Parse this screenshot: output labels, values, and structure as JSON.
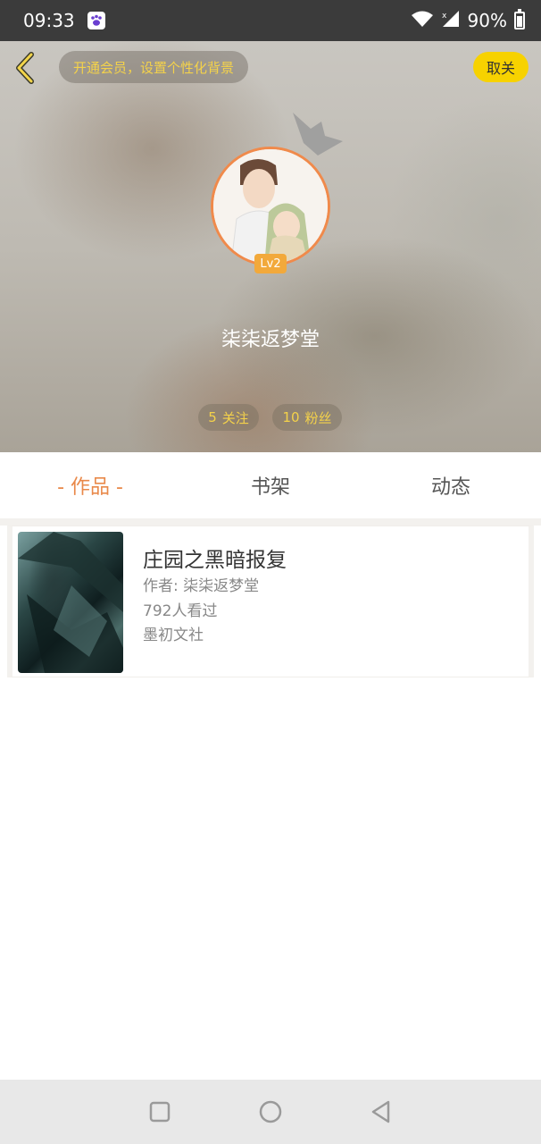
{
  "status_bar": {
    "time": "09:33",
    "battery": "90%"
  },
  "header": {
    "vip_banner": "开通会员，设置个性化背景",
    "unfollow_label": "取关",
    "level": "Lv2",
    "username": "柒柒返梦堂",
    "follow_count": "5",
    "follow_label": "关注",
    "fans_count": "10",
    "fans_label": "粉丝"
  },
  "tabs": [
    {
      "label": "- 作品 -",
      "active": true
    },
    {
      "label": "书架",
      "active": false
    },
    {
      "label": "动态",
      "active": false
    }
  ],
  "works": [
    {
      "title": "庄园之黑暗报复",
      "author": "作者: 柒柒返梦堂",
      "views": "792人看过",
      "publisher": "墨初文社"
    }
  ],
  "colors": {
    "accent_orange": "#e9894a",
    "vip_yellow": "#f4d24a",
    "unfollow_bg": "#f7d200"
  }
}
